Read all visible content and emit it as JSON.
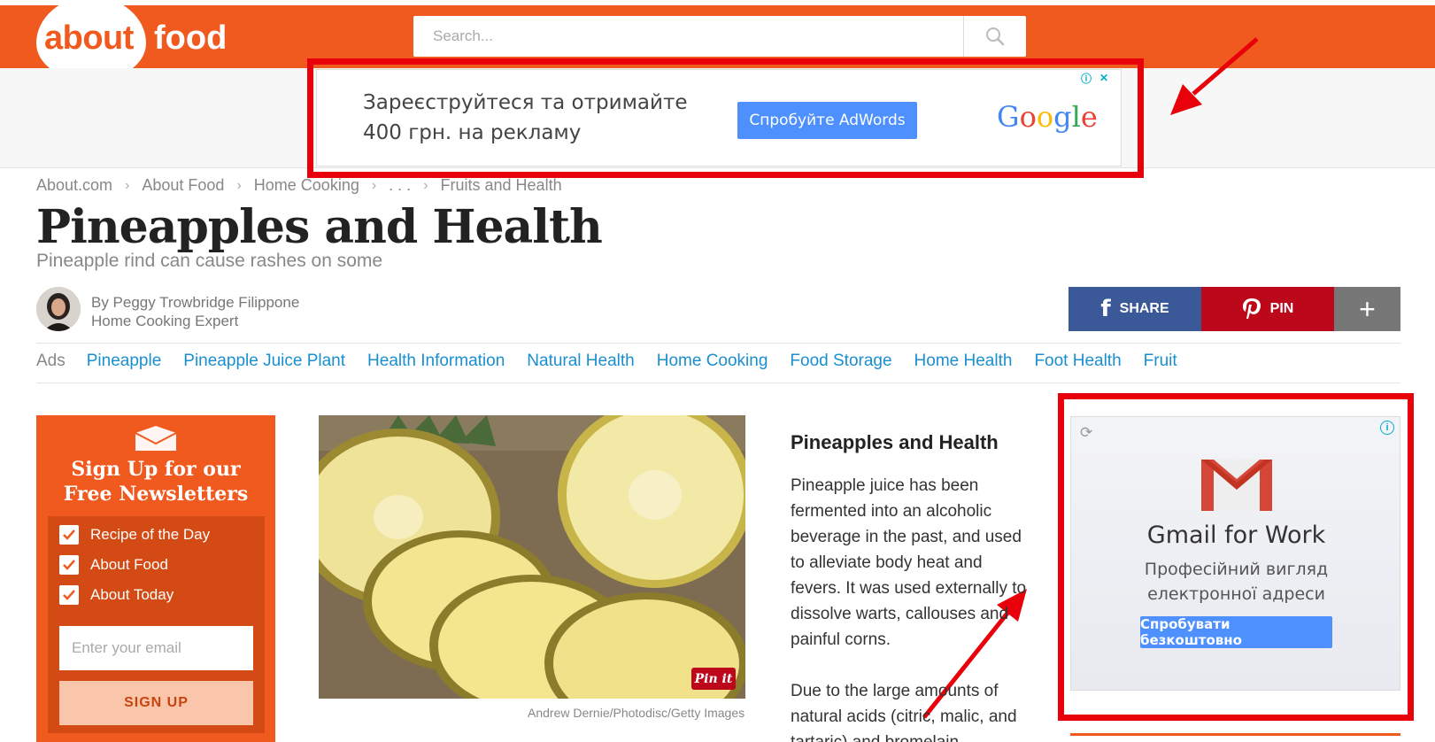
{
  "header": {
    "logo_about": "about",
    "logo_food": "food",
    "search_placeholder": "Search...",
    "brand_color": "#f15a1f"
  },
  "top_ad": {
    "text_line1": "Зареєструйтеся та отримайте",
    "text_line2": "400 грн. на рекламу",
    "button_label": "Спробуйте AdWords",
    "brand": "Google"
  },
  "breadcrumb": [
    "About.com",
    "About Food",
    "Home Cooking",
    ". . .",
    "Fruits and Health"
  ],
  "article": {
    "title": "Pineapples and Health",
    "subtitle": "Pineapple rind can cause rashes on some",
    "author_name": "By Peggy Trowbridge Filippone",
    "author_role": "Home Cooking Expert",
    "heading": "Pineapples and Health",
    "para1": "Pineapple juice has been fermented into an alcoholic beverage in the past, and used to alleviate body heat and fevers. It was used externally to dissolve warts, callouses and painful corns.",
    "para2": "Due to the large amounts of natural acids (citric, malic, and tartaric) and bromelain"
  },
  "share": {
    "facebook_label": "SHARE",
    "pinterest_label": "PIN",
    "more_label": "+"
  },
  "ads_row": {
    "label": "Ads",
    "links": [
      "Pineapple",
      "Pineapple Juice Plant",
      "Health Information",
      "Natural Health",
      "Home Cooking",
      "Food Storage",
      "Home Health",
      "Foot Health",
      "Fruit"
    ]
  },
  "newsletter": {
    "title_line1": "Sign Up for our",
    "title_line2": "Free Newsletters",
    "options": [
      "Recipe of the Day",
      "About Food",
      "About Today"
    ],
    "email_placeholder": "Enter your email",
    "signup_label": "SIGN UP"
  },
  "image": {
    "pinit_label": "Pin it",
    "credit": "Andrew Dernie/Photodisc/Getty Images"
  },
  "right_ad": {
    "title": "Gmail for Work",
    "sub_line1": "Професійний вигляд",
    "sub_line2": "електронної адреси",
    "button_label": "Спробувати безкоштовно"
  }
}
